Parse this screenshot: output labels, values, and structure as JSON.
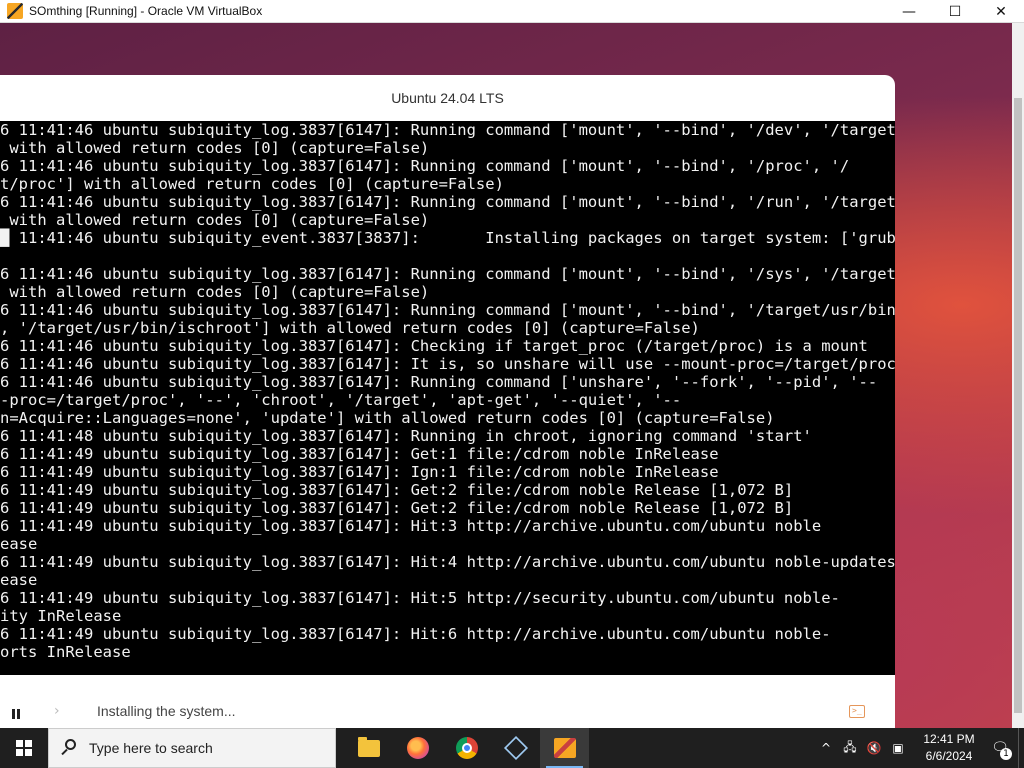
{
  "vbox_window": {
    "title": "SOmthing [Running] - Oracle VM VirtualBox",
    "minimize_label": "—",
    "maximize_label": "☐",
    "close_label": "✕"
  },
  "installer": {
    "window_title": "Ubuntu 24.04 LTS",
    "status_text": "Installing the system...",
    "log_lines": [
      "6 11:41:46 ubuntu subiquity_log.3837[6147]: Running command ['mount', '--bind', '/dev', '/target/",
      " with allowed return codes [0] (capture=False)",
      "6 11:41:46 ubuntu subiquity_log.3837[6147]: Running command ['mount', '--bind', '/proc', '/",
      "t/proc'] with allowed return codes [0] (capture=False)",
      "6 11:41:46 ubuntu subiquity_log.3837[6147]: Running command ['mount', '--bind', '/run', '/target/",
      " with allowed return codes [0] (capture=False)",
      "█ 11:41:46 ubuntu subiquity_event.3837[3837]:       Installing packages on target system: ['grub-",
      "",
      "6 11:41:46 ubuntu subiquity_log.3837[6147]: Running command ['mount', '--bind', '/sys', '/target/",
      " with allowed return codes [0] (capture=False)",
      "6 11:41:46 ubuntu subiquity_log.3837[6147]: Running command ['mount', '--bind', '/target/usr/bin/",
      ", '/target/usr/bin/ischroot'] with allowed return codes [0] (capture=False)",
      "6 11:41:46 ubuntu subiquity_log.3837[6147]: Checking if target_proc (/target/proc) is a mount",
      "6 11:41:46 ubuntu subiquity_log.3837[6147]: It is, so unshare will use --mount-proc=/target/proc",
      "6 11:41:46 ubuntu subiquity_log.3837[6147]: Running command ['unshare', '--fork', '--pid', '--",
      "-proc=/target/proc', '--', 'chroot', '/target', 'apt-get', '--quiet', '--",
      "n=Acquire::Languages=none', 'update'] with allowed return codes [0] (capture=False)",
      "6 11:41:48 ubuntu subiquity_log.3837[6147]: Running in chroot, ignoring command 'start'",
      "6 11:41:49 ubuntu subiquity_log.3837[6147]: Get:1 file:/cdrom noble InRelease",
      "6 11:41:49 ubuntu subiquity_log.3837[6147]: Ign:1 file:/cdrom noble InRelease",
      "6 11:41:49 ubuntu subiquity_log.3837[6147]: Get:2 file:/cdrom noble Release [1,072 B]",
      "6 11:41:49 ubuntu subiquity_log.3837[6147]: Get:2 file:/cdrom noble Release [1,072 B]",
      "6 11:41:49 ubuntu subiquity_log.3837[6147]: Hit:3 http://archive.ubuntu.com/ubuntu noble",
      "ease",
      "6 11:41:49 ubuntu subiquity_log.3837[6147]: Hit:4 http://archive.ubuntu.com/ubuntu noble-updates",
      "ease",
      "6 11:41:49 ubuntu subiquity_log.3837[6147]: Hit:5 http://security.ubuntu.com/ubuntu noble-",
      "ity InRelease",
      "6 11:41:49 ubuntu subiquity_log.3837[6147]: Hit:6 http://archive.ubuntu.com/ubuntu noble-",
      "orts InRelease"
    ],
    "icons": {
      "pause": "pause-icon",
      "nav": "chevron-right-icon",
      "terminal": "terminal-icon"
    },
    "nav_glyph": "›",
    "terminal_glyph": ">_"
  },
  "taskbar": {
    "search_placeholder": "Type here to search",
    "apps": [
      "file-explorer",
      "firefox",
      "chrome",
      "virtualbox-manager",
      "virtualbox-vm"
    ],
    "tray": {
      "chevron": "^",
      "network": "🖧",
      "volume": "🔇",
      "display": "▣"
    },
    "time": "12:41 PM",
    "date": "6/6/2024",
    "notification_count": "1",
    "notification_glyph": "🗨"
  },
  "colors": {
    "terminal_bg": "#000000",
    "terminal_fg": "#f2f2f2",
    "taskbar_bg": "#1f1f1f",
    "accent": "#e5965a"
  }
}
